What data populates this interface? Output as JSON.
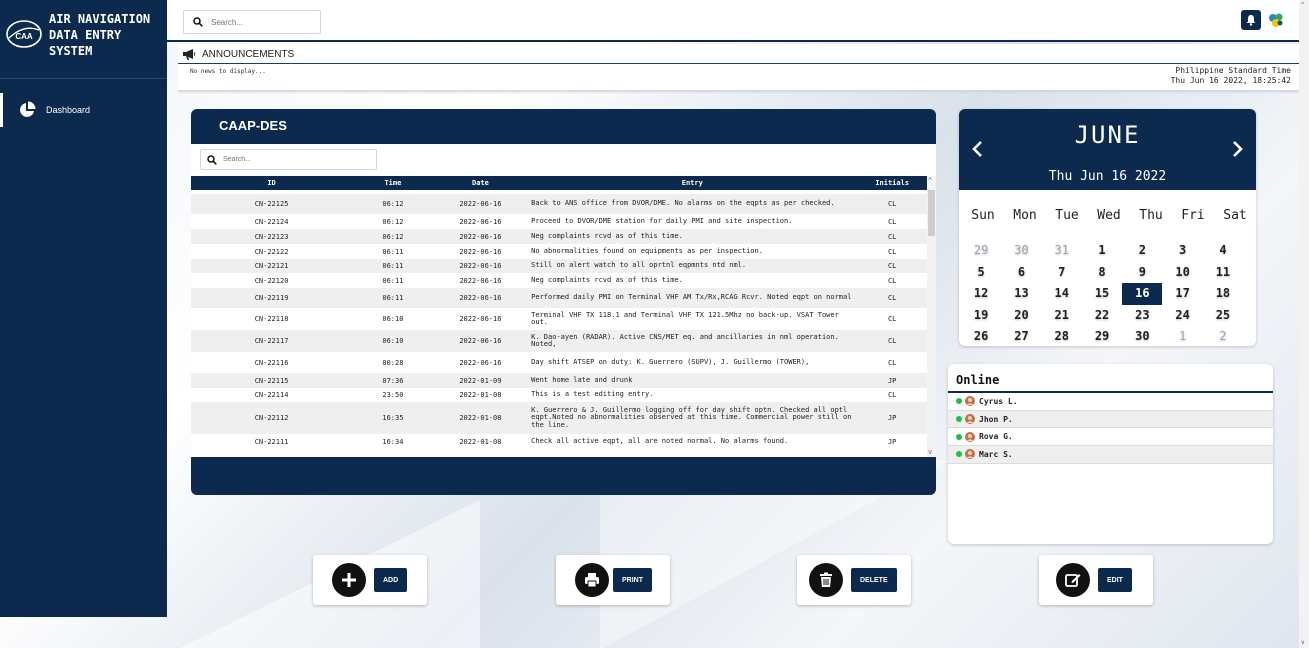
{
  "app": {
    "title": "AIR NAVIGATION DATA ENTRY SYSTEM",
    "logo_text": "CAA"
  },
  "sidebar": {
    "items": [
      {
        "label": "Dashboard"
      }
    ]
  },
  "topbar": {
    "search_placeholder": "Search..."
  },
  "announcements": {
    "title": "ANNOUNCEMENTS",
    "empty_text": "No news to display...",
    "timezone": "Philippine Standard Time",
    "datetime": "Thu Jun 16 2022, 18:25:42"
  },
  "log": {
    "title": "CAAP-DES",
    "search_placeholder": "Search...",
    "columns": [
      "ID",
      "Time",
      "Date",
      "Entry",
      "Initials"
    ],
    "rows": [
      {
        "id": "CN-22125",
        "time": "06:12",
        "date": "2022-06-16",
        "entry": "Back to ANS office from DVOR/DME. No alarms on the eqpts as per checked.",
        "initials": "CL"
      },
      {
        "id": "CN-22124",
        "time": "06:12",
        "date": "2022-06-16",
        "entry": "Proceed to DVOR/DME station for daily PMI and site inspection.",
        "initials": "CL"
      },
      {
        "id": "CN-22123",
        "time": "06:12",
        "date": "2022-06-16",
        "entry": "Neg complaints rcvd as of this time.",
        "initials": "CL"
      },
      {
        "id": "CN-22122",
        "time": "06:11",
        "date": "2022-06-16",
        "entry": "No abnormalities found on equipments as per inspection.",
        "initials": "CL"
      },
      {
        "id": "CN-22121",
        "time": "06:11",
        "date": "2022-06-16",
        "entry": "Still on alert watch to all oprtnl eqpmnts ntd nml.",
        "initials": "CL"
      },
      {
        "id": "CN-22120",
        "time": "06:11",
        "date": "2022-06-16",
        "entry": "Neg complaints rcvd as of this time.",
        "initials": "CL"
      },
      {
        "id": "CN-22119",
        "time": "06:11",
        "date": "2022-06-16",
        "entry": "Performed daily PMI on Terminal VHF AM Tx/Rx,RCAG Rcvr. Noted eqpt on normal",
        "initials": "CL"
      },
      {
        "id": "CN-22118",
        "time": "06:10",
        "date": "2022-06-16",
        "entry": "Terminal VHF TX 118.1 and Terminal VHF TX 121.5Mhz no back-up. VSAT Tower out.",
        "initials": "CL"
      },
      {
        "id": "CN-22117",
        "time": "06:10",
        "date": "2022-06-16",
        "entry": "K. Dao-ayen (RADAR). Active CNS/MET eq. and ancillaries in nml operation. Noted,",
        "initials": "CL"
      },
      {
        "id": "CN-22116",
        "time": "00:28",
        "date": "2022-06-16",
        "entry": "Day shift ATSEP on duty: K. Guerrero (SUPV), J. Guillermo (TOWER),",
        "initials": "CL"
      },
      {
        "id": "CN-22115",
        "time": "07:36",
        "date": "2022-01-09",
        "entry": "Went home late and drunk",
        "initials": "JP"
      },
      {
        "id": "CN-22114",
        "time": "23:50",
        "date": "2022-01-08",
        "entry": "This is a test editing entry.",
        "initials": "CL"
      },
      {
        "id": "CN-22112",
        "time": "16:35",
        "date": "2022-01-08",
        "entry": "K. Guerrero & J. Guillermo logging off for day shift optn. Checked all optl eqpt.Noted no abnormalities observed at this time. Commercial power still on the line.",
        "initials": "JP"
      },
      {
        "id": "CN-22111",
        "time": "16:34",
        "date": "2022-01-08",
        "entry": "Check all active eqpt, all are noted normal. No alarms found.",
        "initials": "JP"
      }
    ]
  },
  "calendar": {
    "month": "JUNE",
    "today": "Thu Jun 16 2022",
    "weekdays": [
      "Sun",
      "Mon",
      "Tue",
      "Wed",
      "Thu",
      "Fri",
      "Sat"
    ],
    "days": [
      "29",
      "30",
      "31",
      "1",
      "2",
      "3",
      "4",
      "5",
      "6",
      "7",
      "8",
      "9",
      "10",
      "11",
      "12",
      "13",
      "14",
      "15",
      "16",
      "17",
      "18",
      "19",
      "20",
      "21",
      "22",
      "23",
      "24",
      "25",
      "26",
      "27",
      "28",
      "29",
      "30",
      "1",
      "2"
    ],
    "muted_indices": [
      0,
      1,
      2,
      33,
      34
    ],
    "selected_index": 18
  },
  "online": {
    "title": "Online",
    "users": [
      "Cyrus L.",
      "Jhon P.",
      "Rova G.",
      "Marc S."
    ]
  },
  "actions": {
    "add": "ADD",
    "print": "PRINT",
    "delete": "DELETE",
    "edit": "EDIT"
  },
  "colors": {
    "navy": "#0b2a4e",
    "online_dot": "#19c24a"
  }
}
